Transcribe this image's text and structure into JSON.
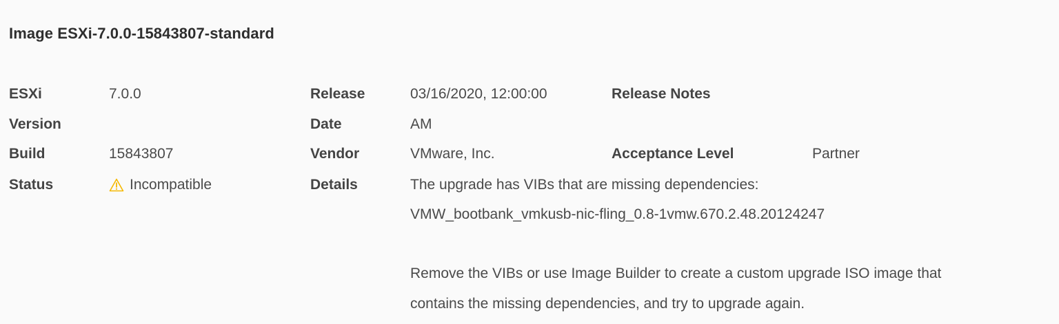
{
  "header": {
    "title": "Image ESXi-7.0.0-15843807-standard"
  },
  "details": {
    "esxi_version_label_line1": "ESXi",
    "esxi_version_label_line2": "Version",
    "esxi_version_value": "7.0.0",
    "release_date_label_line1": "Release",
    "release_date_label_line2": "Date",
    "release_date_value_line1": "03/16/2020, 12:00:00",
    "release_date_value_line2": "AM",
    "release_notes_label": "Release Notes",
    "build_label": "Build",
    "build_value": "15843807",
    "vendor_label": "Vendor",
    "vendor_value": "VMware, Inc.",
    "acceptance_level_label": "Acceptance Level",
    "acceptance_level_value": "Partner",
    "status_label": "Status",
    "status_value": "Incompatible",
    "status_icon": "warning-icon",
    "status_color": "#f5b800",
    "details_label": "Details",
    "details_line1": "The upgrade has VIBs that are missing dependencies:",
    "details_line2": "VMW_bootbank_vmkusb-nic-fling_0.8-1vmw.670.2.48.20124247",
    "details_line3": "Remove the VIBs or use Image Builder to create a custom upgrade ISO image that",
    "details_line4": "contains the missing dependencies, and try to upgrade again."
  }
}
